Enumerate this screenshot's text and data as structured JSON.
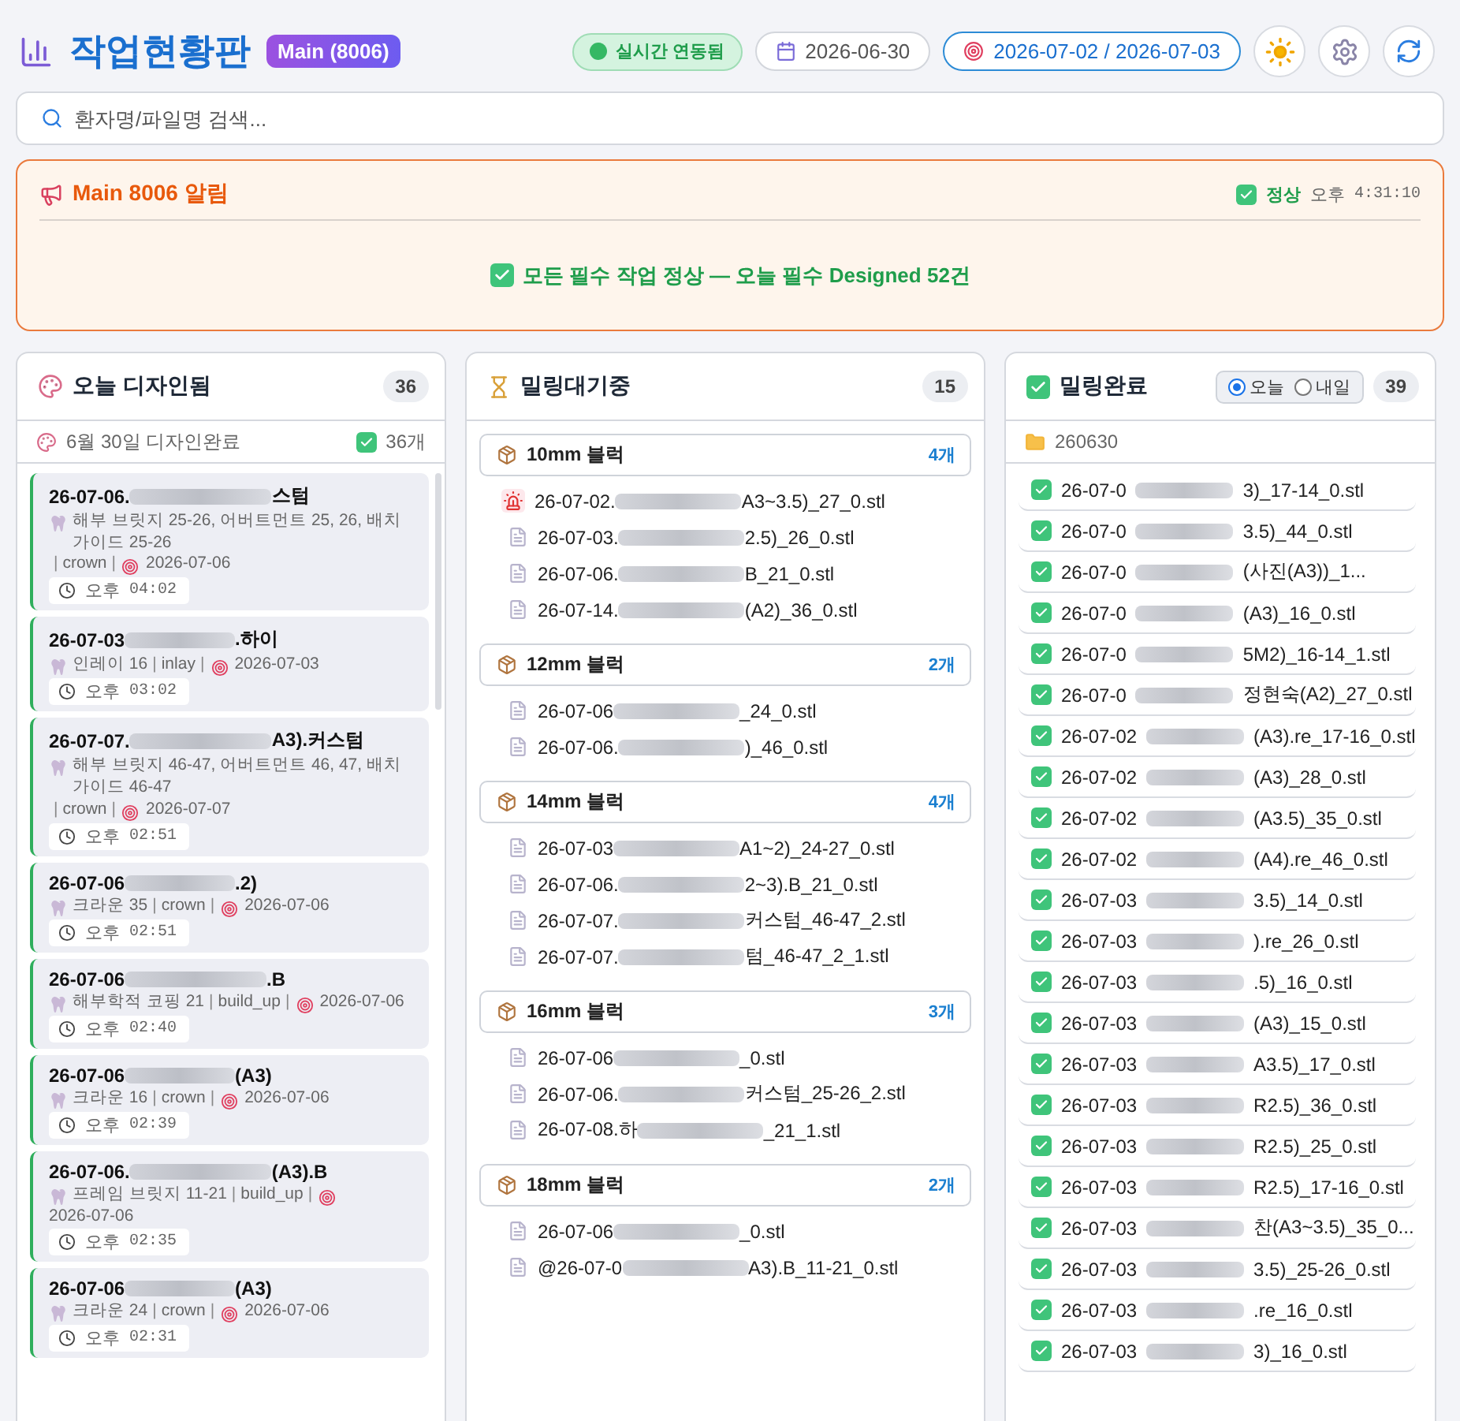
{
  "header": {
    "title": "작업현황판",
    "server_badge": "Main (8006)",
    "live_status": {
      "label": "실시간 연동됨",
      "connected": true
    },
    "date": "2026-06-30",
    "date_range": "2026-07-02 / 2026-07-03"
  },
  "search": {
    "placeholder": "환자명/파일명 검색..."
  },
  "alert": {
    "title": "Main 8006 알림",
    "status": "정상",
    "time_period": "오후",
    "time": "4:31:10",
    "message": "모든 필수 작업 정상 — 오늘 필수 Designed 52건"
  },
  "designed_column": {
    "title": "오늘 디자인됨",
    "separator": "|",
    "count": "36",
    "summary": "6월 30일 디자인완료",
    "summary_count": "36개",
    "cards": [
      {
        "name_start": "26-07-06.",
        "name_end": "스텀",
        "work": "해부 브릿지 25-26, 어버트먼트 25, 26, 배치 가이드 25-26",
        "type": "crown",
        "due": "2026-07-06",
        "period": "오후",
        "time": "04:02"
      },
      {
        "name_start": "26-07-03",
        "name_end": ".하이",
        "work": "인레이 16",
        "type": "inlay",
        "due": "2026-07-03",
        "period": "오후",
        "time": "03:02"
      },
      {
        "name_start": "26-07-07.",
        "name_end": "A3).커스텀",
        "work": "해부 브릿지 46-47, 어버트먼트 46, 47, 배치 가이드 46-47",
        "type": "crown",
        "due": "2026-07-07",
        "period": "오후",
        "time": "02:51"
      },
      {
        "name_start": "26-07-06",
        "name_end": ".2)",
        "work": "크라운 35",
        "type": "crown",
        "due": "2026-07-06",
        "period": "오후",
        "time": "02:51"
      },
      {
        "name_start": "26-07-06",
        "name_end": ".B",
        "work": "해부학적 코핑 21",
        "type": "build_up",
        "due": "2026-07-06",
        "period": "오후",
        "time": "02:40"
      },
      {
        "name_start": "26-07-06",
        "name_end": "(A3)",
        "work": "크라운 16",
        "type": "crown",
        "due": "2026-07-06",
        "period": "오후",
        "time": "02:39"
      },
      {
        "name_start": "26-07-06.",
        "name_end": "(A3).B",
        "work": "프레임 브릿지 11-21",
        "type": "build_up",
        "due": "2026-07-06",
        "period": "오후",
        "time": "02:35"
      },
      {
        "name_start": "26-07-06",
        "name_end": "(A3)",
        "work": "크라운 24",
        "type": "crown",
        "due": "2026-07-06",
        "period": "오후",
        "time": "02:31"
      }
    ]
  },
  "waiting_column": {
    "title": "밀링대기중",
    "count": "15",
    "groups": [
      {
        "label": "10mm 블럭",
        "count": "4개",
        "files": [
          {
            "kind": "alert",
            "name_start": "26-07-02.",
            "name_end": "A3~3.5)_27_0.stl"
          },
          {
            "kind": "file",
            "name_start": "26-07-03.",
            "name_end": "2.5)_26_0.stl"
          },
          {
            "kind": "file",
            "name_start": "26-07-06.",
            "name_end": "B_21_0.stl"
          },
          {
            "kind": "file",
            "name_start": "26-07-14.",
            "name_end": "(A2)_36_0.stl"
          }
        ]
      },
      {
        "label": "12mm 블럭",
        "count": "2개",
        "files": [
          {
            "kind": "file",
            "name_start": "26-07-06",
            "name_end": "_24_0.stl"
          },
          {
            "kind": "file",
            "name_start": "26-07-06.",
            "name_end": ")_46_0.stl"
          }
        ]
      },
      {
        "label": "14mm 블럭",
        "count": "4개",
        "files": [
          {
            "kind": "file",
            "name_start": "26-07-03",
            "name_end": "A1~2)_24-27_0.stl"
          },
          {
            "kind": "file",
            "name_start": "26-07-06.",
            "name_end": "2~3).B_21_0.stl"
          },
          {
            "kind": "file",
            "name_start": "26-07-07.",
            "name_end": "커스텀_46-47_2.stl"
          },
          {
            "kind": "file",
            "name_start": "26-07-07.",
            "name_end": "텀_46-47_2_1.stl"
          }
        ]
      },
      {
        "label": "16mm 블럭",
        "count": "3개",
        "files": [
          {
            "kind": "file",
            "name_start": "26-07-06",
            "name_end": "_0.stl"
          },
          {
            "kind": "file",
            "name_start": "26-07-06.",
            "name_end": "커스텀_25-26_2.stl"
          },
          {
            "kind": "file",
            "name_start": "26-07-08.하",
            "name_end": "_21_1.stl"
          }
        ]
      },
      {
        "label": "18mm 블럭",
        "count": "2개",
        "files": [
          {
            "kind": "file",
            "name_start": "26-07-06",
            "name_end": "_0.stl"
          },
          {
            "kind": "file",
            "name_start": "@26-07-0",
            "name_end": "A3).B_11-21_0.stl"
          }
        ]
      }
    ]
  },
  "done_column": {
    "title": "밀링완료",
    "day_options": [
      {
        "label": "오늘",
        "selected": true
      },
      {
        "label": "내일",
        "selected": false
      }
    ],
    "count": "39",
    "folder": "260630",
    "files": [
      {
        "name_start": "26-07-0",
        "name_end": "3)_17-14_0.stl"
      },
      {
        "name_start": "26-07-0",
        "name_end": "3.5)_44_0.stl"
      },
      {
        "name_start": "26-07-0",
        "name_end": "(사진(A3))_1..."
      },
      {
        "name_start": "26-07-0",
        "name_end": "(A3)_16_0.stl"
      },
      {
        "name_start": "26-07-0",
        "name_end": "5M2)_16-14_1.stl"
      },
      {
        "name_start": "26-07-0",
        "name_end": "정현숙(A2)_27_0.stl"
      },
      {
        "name_start": "26-07-02",
        "name_end": "(A3).re_17-16_0.stl"
      },
      {
        "name_start": "26-07-02",
        "name_end": "(A3)_28_0.stl"
      },
      {
        "name_start": "26-07-02",
        "name_end": "(A3.5)_35_0.stl"
      },
      {
        "name_start": "26-07-02",
        "name_end": "(A4).re_46_0.stl"
      },
      {
        "name_start": "26-07-03",
        "name_end": "3.5)_14_0.stl"
      },
      {
        "name_start": "26-07-03",
        "name_end": ").re_26_0.stl"
      },
      {
        "name_start": "26-07-03",
        "name_end": ".5)_16_0.stl"
      },
      {
        "name_start": "26-07-03",
        "name_end": "(A3)_15_0.stl"
      },
      {
        "name_start": "26-07-03",
        "name_end": "A3.5)_17_0.stl"
      },
      {
        "name_start": "26-07-03",
        "name_end": "R2.5)_36_0.stl"
      },
      {
        "name_start": "26-07-03",
        "name_end": "R2.5)_25_0.stl"
      },
      {
        "name_start": "26-07-03",
        "name_end": "R2.5)_17-16_0.stl"
      },
      {
        "name_start": "26-07-03",
        "name_end": "찬(A3~3.5)_35_0..."
      },
      {
        "name_start": "26-07-03",
        "name_end": "3.5)_25-26_0.stl"
      },
      {
        "name_start": "26-07-03",
        "name_end": ".re_16_0.stl"
      },
      {
        "name_start": "26-07-03",
        "name_end": "3)_16_0.stl"
      }
    ]
  }
}
